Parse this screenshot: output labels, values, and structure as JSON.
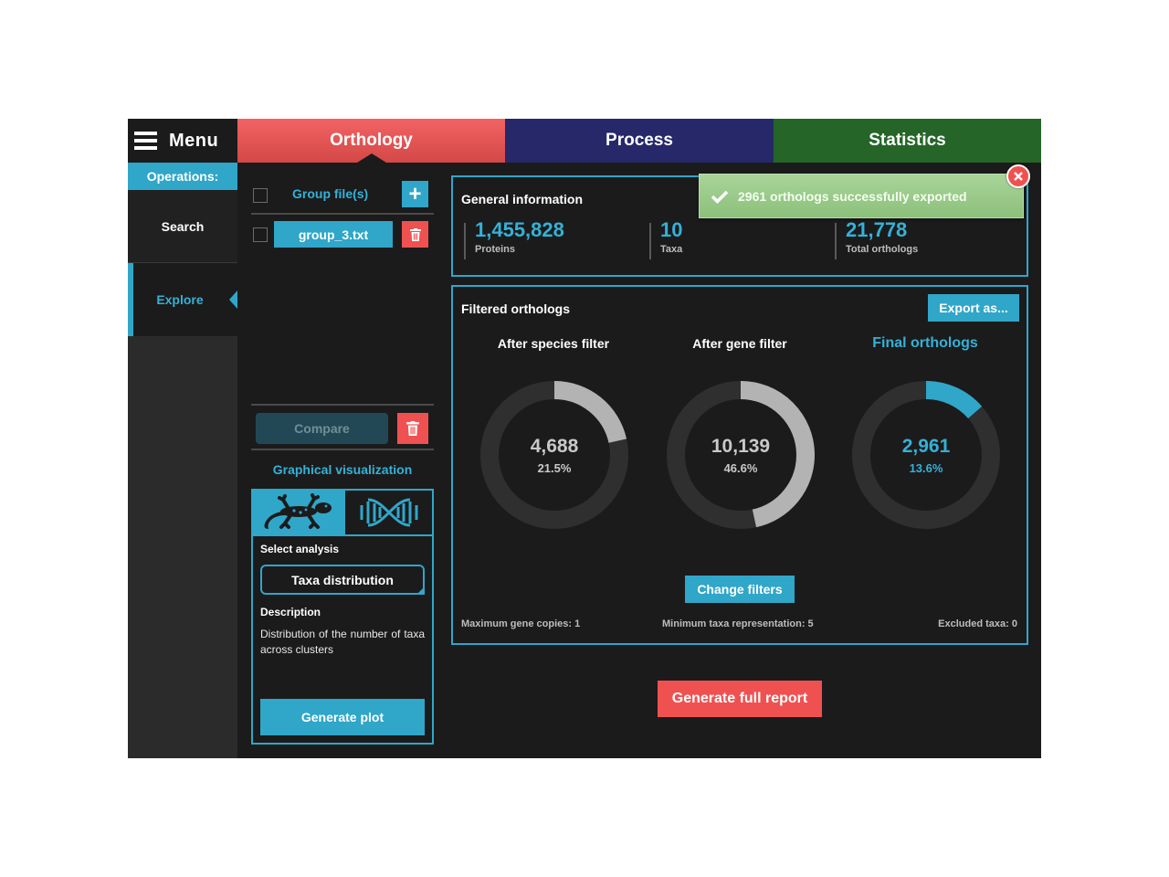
{
  "menu": {
    "label": "Menu",
    "icon": "hamburger-icon"
  },
  "tabs": [
    {
      "label": "Orthology",
      "color": "#e85555"
    },
    {
      "label": "Process",
      "color": "#26286a"
    },
    {
      "label": "Statistics",
      "color": "#256628"
    }
  ],
  "sidebar": {
    "operations_label": "Operations:",
    "items": [
      {
        "label": "Search",
        "active": false
      },
      {
        "label": "Explore",
        "active": true
      }
    ]
  },
  "files": {
    "header": "Group file(s)",
    "items": [
      {
        "name": "group_3.txt"
      }
    ],
    "compare_label": "Compare"
  },
  "graph": {
    "title": "Graphical visualization",
    "select_label": "Select analysis",
    "selected_analysis": "Taxa distribution",
    "description_label": "Description",
    "description": "Distribution of the number of taxa across clusters",
    "generate_label": "Generate plot",
    "icons": [
      "gecko-icon",
      "dna-icon"
    ]
  },
  "general_info": {
    "title": "General information",
    "stats": [
      {
        "value": "1,455,828",
        "label": "Proteins"
      },
      {
        "value": "10",
        "label": "Taxa"
      },
      {
        "value": "21,778",
        "label": "Total orthologs"
      }
    ]
  },
  "toast": {
    "message": "2961 orthologs successfully exported"
  },
  "filtered": {
    "title": "Filtered orthologs",
    "export_label": "Export as...",
    "donuts": [
      {
        "title": "After species filter",
        "value": "4,688",
        "percent": "21.5%",
        "fraction": 0.215,
        "color": "#b3b3b3"
      },
      {
        "title": "After gene filter",
        "value": "10,139",
        "percent": "46.6%",
        "fraction": 0.466,
        "color": "#b3b3b3"
      },
      {
        "title": "Final orthologs",
        "value": "2,961",
        "percent": "13.6%",
        "fraction": 0.136,
        "color": "#30a6c9"
      }
    ],
    "change_label": "Change filters",
    "footer": {
      "max_gene_copies": "Maximum gene copies: 1",
      "min_taxa": "Minimum taxa representation: 5",
      "excluded_taxa": "Excluded taxa: 0"
    }
  },
  "report_label": "Generate full report",
  "colors": {
    "accent": "#30a6c9",
    "danger": "#ef5151",
    "bg": "#1b1b1c",
    "track": "#2f2f30"
  }
}
